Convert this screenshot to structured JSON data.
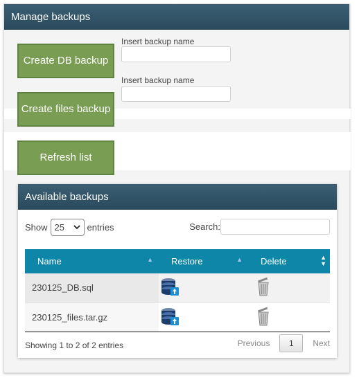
{
  "panel": {
    "title": "Manage backups"
  },
  "db_backup": {
    "button_label": "Create DB backup",
    "name_label": "Insert backup name",
    "name_value": ""
  },
  "files_backup": {
    "button_label": "Create files backup",
    "name_label": "Insert backup name",
    "name_value": ""
  },
  "refresh": {
    "button_label": "Refresh list"
  },
  "available": {
    "title": "Available backups",
    "show_prefix": "Show",
    "show_value": "25",
    "show_suffix": "entries",
    "search_label": "Search:",
    "search_value": "",
    "columns": [
      "Name",
      "Restore",
      "Delete"
    ],
    "rows": [
      {
        "name": "230125_DB.sql",
        "restore_icon": "database-restore-icon",
        "delete_icon": "trash-icon"
      },
      {
        "name": "230125_files.tar.gz",
        "restore_icon": "database-restore-icon",
        "delete_icon": "trash-icon"
      }
    ],
    "info": "Showing 1 to 2 of 2 entries",
    "pagination": {
      "previous": "Previous",
      "page": "1",
      "next": "Next"
    }
  },
  "colors": {
    "header_gradient": "#2a4a5c",
    "button_green": "#799d52",
    "table_header": "#0e86a8"
  }
}
